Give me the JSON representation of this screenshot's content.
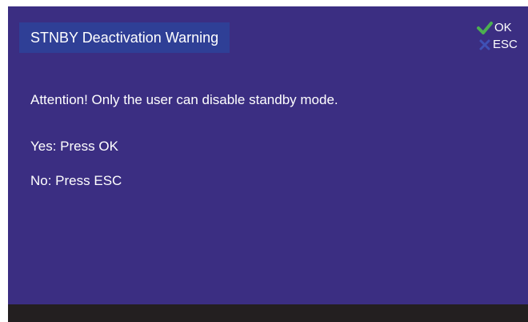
{
  "dialog": {
    "title": "STNBY Deactivation Warning",
    "lines": [
      "Attention! Only the user can disable standby mode.",
      "Yes: Press OK",
      "No: Press ESC"
    ]
  },
  "softkeys": {
    "ok": {
      "label": "OK",
      "icon": "checkmark-icon",
      "color": "#4caf50"
    },
    "esc": {
      "label": "ESC",
      "icon": "x-icon",
      "color": "#3f51b5"
    }
  },
  "colors": {
    "panel": "#3b2e82",
    "title_bar": "#2f3f96",
    "text": "#ffffff",
    "bottom_bar": "#231f20"
  }
}
